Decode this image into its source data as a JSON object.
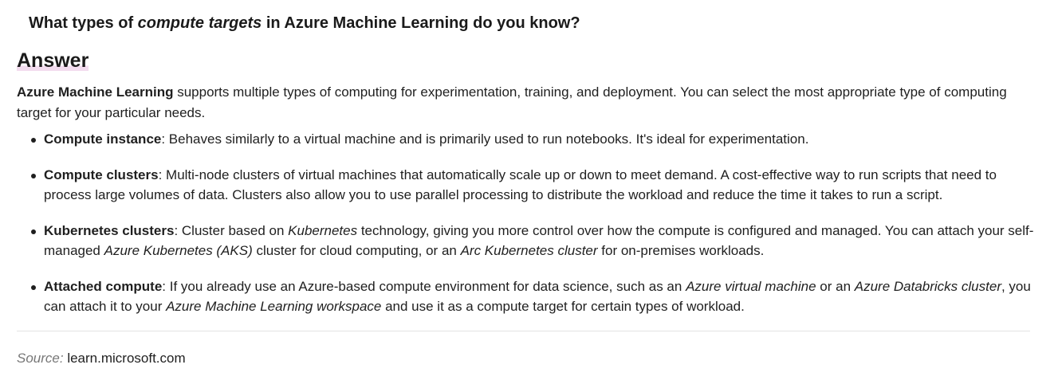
{
  "question": {
    "prefix": "What types of ",
    "emphasis": "compute targets",
    "suffix": " in Azure Machine Learning do you know?"
  },
  "answer_heading": "Answer",
  "intro": {
    "bold": "Azure Machine Learning",
    "text": " supports multiple types of computing for experimentation, training, and deployment. You can select the most appropriate type of computing target for your particular needs."
  },
  "items": [
    {
      "term": "Compute instance",
      "parts": [
        {
          "t": ": Behaves similarly to a virtual machine and is primarily used to run notebooks. It's ideal for experimentation.",
          "i": false
        }
      ]
    },
    {
      "term": "Compute clusters",
      "parts": [
        {
          "t": ": Multi-node clusters of virtual machines that automatically scale up or down to meet demand. A cost-effective way to run scripts that need to process large volumes of data. Clusters also allow you to use parallel processing to distribute the workload and reduce the time it takes to run a script.",
          "i": false
        }
      ]
    },
    {
      "term": "Kubernetes clusters",
      "parts": [
        {
          "t": ": Cluster based on ",
          "i": false
        },
        {
          "t": "Kubernetes",
          "i": true
        },
        {
          "t": " technology, giving you more control over how the compute is configured and managed. You can attach your self-managed ",
          "i": false
        },
        {
          "t": "Azure Kubernetes (AKS)",
          "i": true
        },
        {
          "t": " cluster for cloud computing, or an ",
          "i": false
        },
        {
          "t": "Arc Kubernetes cluster",
          "i": true
        },
        {
          "t": " for on-premises workloads.",
          "i": false
        }
      ]
    },
    {
      "term": "Attached compute",
      "parts": [
        {
          "t": ": If you already use an Azure-based compute environment for data science, such as an ",
          "i": false
        },
        {
          "t": "Azure virtual machine",
          "i": true
        },
        {
          "t": " or an ",
          "i": false
        },
        {
          "t": "Azure Databricks cluster",
          "i": true
        },
        {
          "t": ", you can attach it to your ",
          "i": false
        },
        {
          "t": "Azure Machine Learning workspace",
          "i": true
        },
        {
          "t": " and use it as a compute target for certain types of workload.",
          "i": false
        }
      ]
    }
  ],
  "source": {
    "label": "Source:",
    "value": "learn.microsoft.com"
  }
}
